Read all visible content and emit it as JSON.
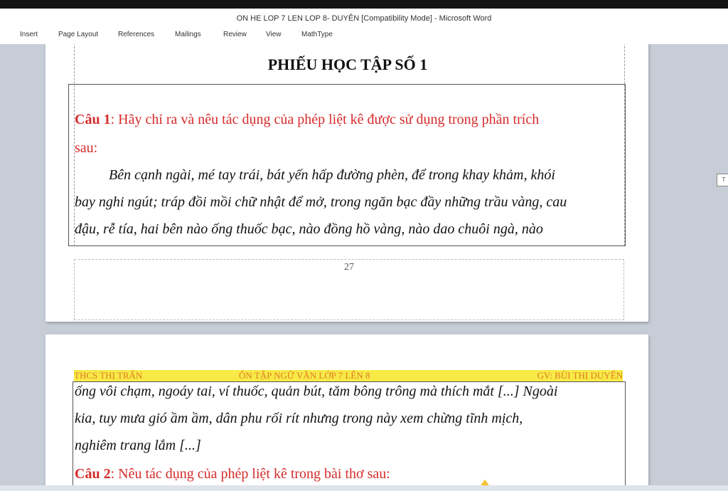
{
  "window": {
    "title": "ON HE LOP 7 LEN LOP 8- DUYÊN [Compatibility Mode]  -  Microsoft Word"
  },
  "ribbon": {
    "tabs": [
      "Insert",
      "Page Layout",
      "References",
      "Mailings",
      "Review",
      "View",
      "MathType"
    ]
  },
  "page1": {
    "heading": "PHIẾU HỌC TẬP SỐ 1",
    "question1_label": "Câu 1",
    "question1_text": ": Hãy chỉ ra và  nêu tác dụng của phép liệt kê được sử dụng trong phần trích",
    "question1_cont": "sau:",
    "passage_lines": [
      "Bên cạnh ngài, mé tay trái, bát yến hấp đường phèn, để trong khay khảm, khói",
      "bay nghi ngút; tráp đồi mồi chữ nhật để mở, trong ngăn bạc đầy những trầu vàng, cau",
      "đậu, rễ tía, hai bên nào ống thuốc bạc, nào đồng hồ vàng, nào dao chuôi ngà, nào"
    ],
    "page_number": "27"
  },
  "page2": {
    "header_left": "THCS THỊ TRẤN",
    "header_center": "ÔN TẬP NGỮ VĂN LỚP 7 LÊN 8",
    "header_right": "GV: BÙI THỊ DUYÊN",
    "passage_lines": [
      "ống vôi chạm, ngoáy tai, ví thuốc, quản bút, tăm bông trông mà thích mắt [...] Ngoài",
      "kia, tuy mưa gió ầm ầm, dân phu rối rít nhưng trong này xem chừng tĩnh mịch,",
      "nghiêm trang lắm [...]"
    ],
    "question2_label": "Câu 2",
    "question2_text": ": Nêu tác dụng của phép liệt kê trong bài thơ sau:"
  },
  "sidemark_text": "T",
  "colors": {
    "question_red": "#d62b2b",
    "header_yellow": "#f7ea47",
    "header_text": "#e07b22"
  }
}
